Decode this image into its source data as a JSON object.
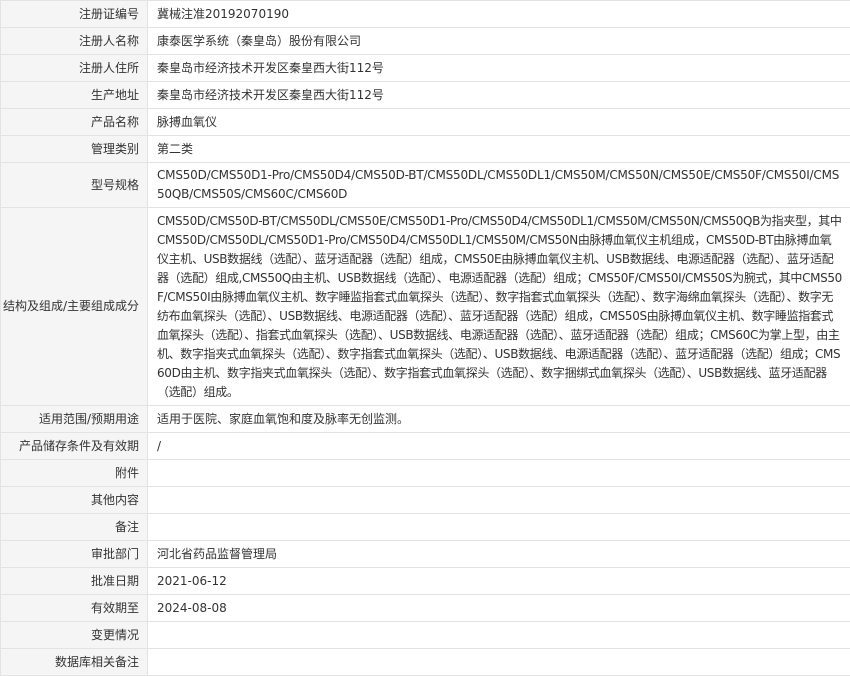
{
  "rows": [
    {
      "label": "注册证编号",
      "value": "冀械注准20192070190"
    },
    {
      "label": "注册人名称",
      "value": "康泰医学系统（秦皇岛）股份有限公司"
    },
    {
      "label": "注册人住所",
      "value": "秦皇岛市经济技术开发区秦皇西大街112号"
    },
    {
      "label": "生产地址",
      "value": "秦皇岛市经济技术开发区秦皇西大街112号"
    },
    {
      "label": "产品名称",
      "value": "脉搏血氧仪"
    },
    {
      "label": "管理类别",
      "value": "第二类"
    },
    {
      "label": "型号规格",
      "value": "CMS50D/CMS50D1-Pro/CMS50D4/CMS50D-BT/CMS50DL/CMS50DL1/CMS50M/CMS50N/CMS50E/CMS50F/CMS50I/CMS50QB/CMS50S/CMS60C/CMS60D"
    },
    {
      "label": "结构及组成/主要组成成分",
      "value": "CMS50D/CMS50D-BT/CMS50DL/CMS50E/CMS50D1-Pro/CMS50D4/CMS50DL1/CMS50M/CMS50N/CMS50QB为指夹型，其中CMS50D/CMS50DL/CMS50D1-Pro/CMS50D4/CMS50DL1/CMS50M/CMS50N由脉搏血氧仪主机组成，CMS50D-BT由脉搏血氧仪主机、USB数据线（选配）、蓝牙适配器（选配）组成，CMS50E由脉搏血氧仪主机、USB数据线、电源适配器（选配）、蓝牙适配器（选配）组成,CMS50Q由主机、USB数据线（选配）、电源适配器（选配）组成；CMS50F/CMS50I/CMS50S为腕式，其中CMS50F/CMS50I由脉搏血氧仪主机、数字睡监指套式血氧探头（选配）、数字指套式血氧探头（选配）、数字海绵血氧探头（选配）、数字无纺布血氧探头（选配）、USB数据线、电源适配器（选配）、蓝牙适配器（选配）组成，CMS50S由脉搏血氧仪主机、数字睡监指套式血氧探头（选配）、指套式血氧探头（选配）、USB数据线、电源适配器（选配）、蓝牙适配器（选配）组成；CMS60C为掌上型，由主机、数字指夹式血氧探头（选配）、数字指套式血氧探头（选配）、USB数据线、电源适配器（选配）、蓝牙适配器（选配）组成；CMS60D由主机、数字指夹式血氧探头（选配）、数字指套式血氧探头（选配）、数字捆绑式血氧探头（选配）、USB数据线、蓝牙适配器（选配）组成。"
    },
    {
      "label": "适用范围/预期用途",
      "value": "适用于医院、家庭血氧饱和度及脉率无创监测。"
    },
    {
      "label": "产品储存条件及有效期",
      "value": "/"
    },
    {
      "label": "附件",
      "value": ""
    },
    {
      "label": "其他内容",
      "value": ""
    },
    {
      "label": "备注",
      "value": ""
    },
    {
      "label": "审批部门",
      "value": "河北省药品监督管理局"
    },
    {
      "label": "批准日期",
      "value": "2021-06-12"
    },
    {
      "label": "有效期至",
      "value": "2024-08-08"
    },
    {
      "label": "变更情况",
      "value": ""
    },
    {
      "label": "数据库相关备注",
      "value": ""
    }
  ]
}
